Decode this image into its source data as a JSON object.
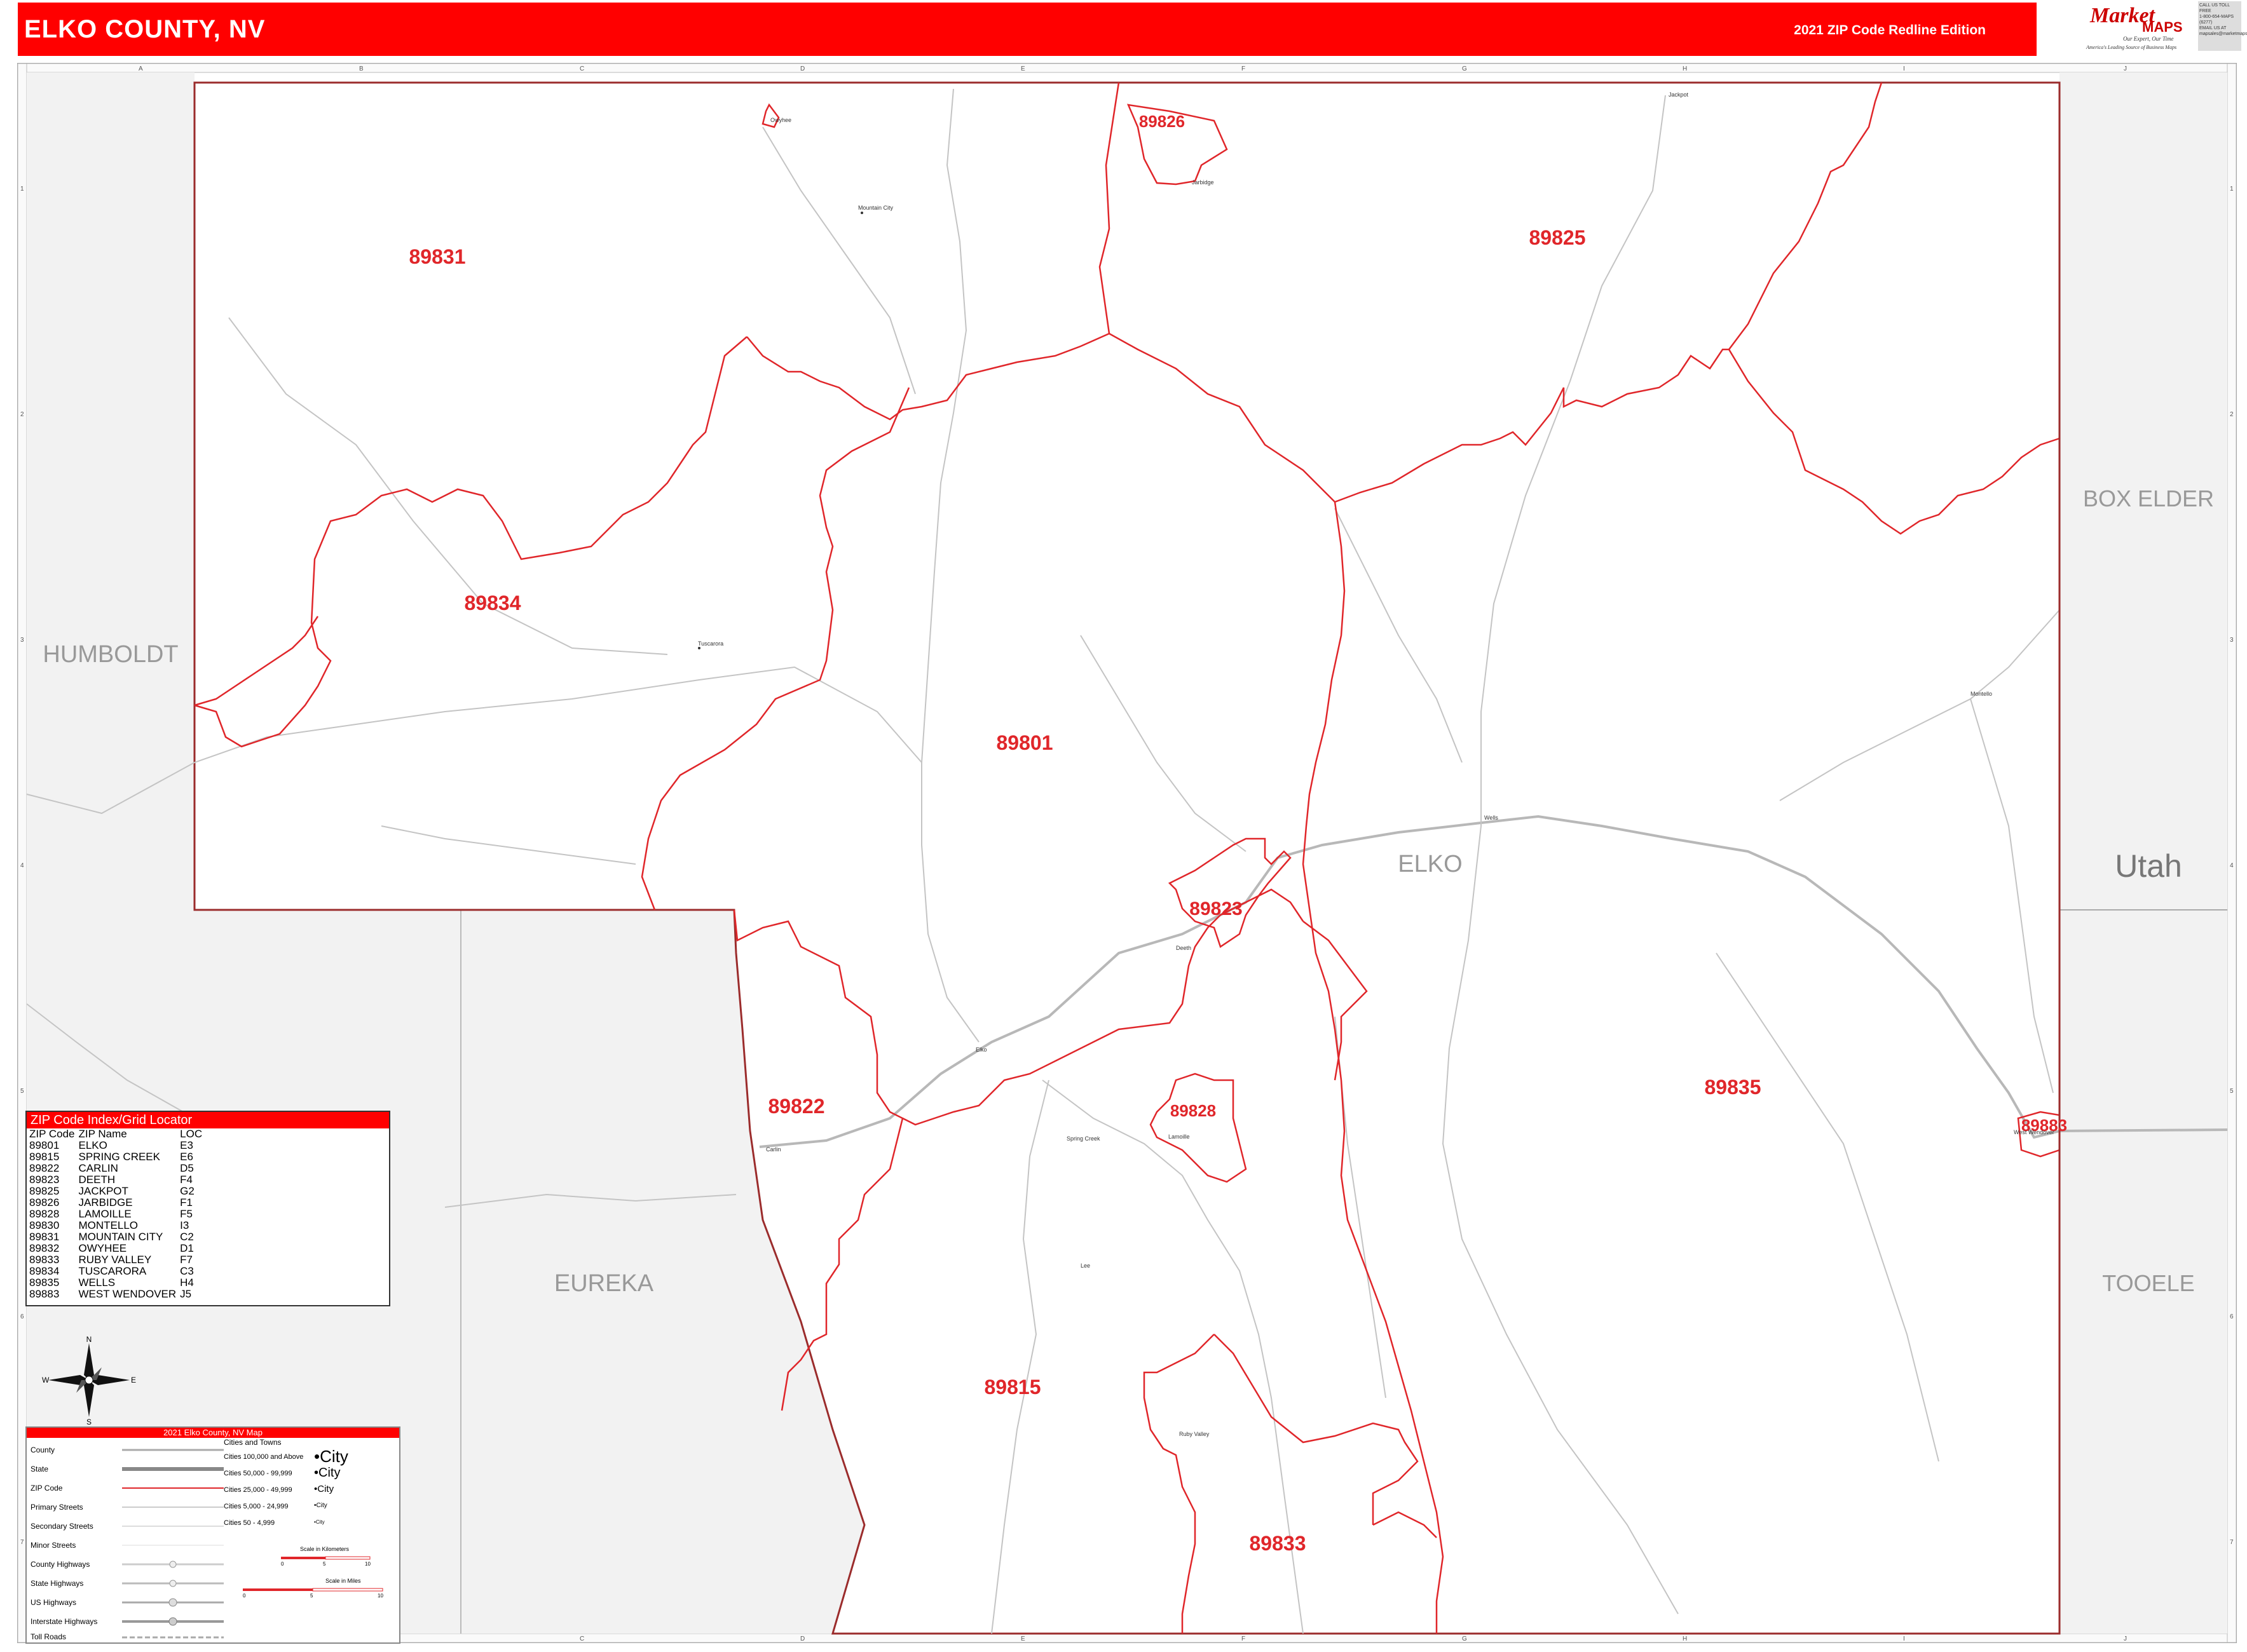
{
  "header": {
    "title": "ELKO COUNTY, NV",
    "edition": "2021 ZIP Code Redline Edition",
    "logo_brand_1": "Market",
    "logo_brand_2": "MAPS",
    "logo_tagline": "Our Expert, Our Time",
    "logo_subtagline": "America's Leading Source of Business Maps",
    "contact_lines": [
      "CALL US TOLL FREE",
      "1-800-654-MAPS (6277)",
      "EMAIL US AT",
      "mapsales@marketmaps.com"
    ]
  },
  "grid": {
    "columns": [
      "A",
      "B",
      "C",
      "D",
      "E",
      "F",
      "G",
      "H",
      "I",
      "J"
    ],
    "rows": [
      "1",
      "2",
      "3",
      "4",
      "5",
      "6",
      "7"
    ]
  },
  "neighbors": {
    "humboldt": "HUMBOLDT",
    "eureka": "EUREKA",
    "box_elder": "BOX ELDER",
    "utah": "Utah",
    "tooele": "TOOELE",
    "elko": "ELKO"
  },
  "zip_labels": {
    "z89826": "89826",
    "z89831": "89831",
    "z89825": "89825",
    "z89834": "89834",
    "z89801": "89801",
    "z89823": "89823",
    "z89822": "89822",
    "z89828": "89828",
    "z89835": "89835",
    "z89883": "89883",
    "z89815": "89815",
    "z89833": "89833"
  },
  "towns": {
    "mountain_city": "Mountain City",
    "tuscarora": "Tuscarora",
    "spring_creek": "Spring Creek",
    "lamoille": "Lamoille",
    "ruby_valley": "Ruby Valley",
    "wells": "Wells",
    "jackpot": "Jackpot",
    "montello": "Montello",
    "west_wendover": "West Wendover",
    "jarbidge": "Jarbidge",
    "carlin": "Carlin",
    "elko_city": "Elko",
    "deeth": "Deeth",
    "owyhee": "Owyhee",
    "lee": "Lee"
  },
  "zip_index": {
    "title": "ZIP Code Index/Grid Locator",
    "headers": [
      "ZIP Code",
      "ZIP Name",
      "LOC"
    ],
    "rows": [
      [
        "89801",
        "ELKO",
        "E3"
      ],
      [
        "89815",
        "SPRING CREEK",
        "E6"
      ],
      [
        "89822",
        "CARLIN",
        "D5"
      ],
      [
        "89823",
        "DEETH",
        "F4"
      ],
      [
        "89825",
        "JACKPOT",
        "G2"
      ],
      [
        "89826",
        "JARBIDGE",
        "F1"
      ],
      [
        "89828",
        "LAMOILLE",
        "F5"
      ],
      [
        "89830",
        "MONTELLO",
        "I3"
      ],
      [
        "89831",
        "MOUNTAIN CITY",
        "C2"
      ],
      [
        "89832",
        "OWYHEE",
        "D1"
      ],
      [
        "89833",
        "RUBY VALLEY",
        "F7"
      ],
      [
        "89834",
        "TUSCARORA",
        "C3"
      ],
      [
        "89835",
        "WELLS",
        "H4"
      ],
      [
        "89883",
        "WEST WENDOVER",
        "J5"
      ]
    ]
  },
  "compass": {
    "n": "N",
    "s": "S",
    "e": "E",
    "w": "W"
  },
  "legend": {
    "title": "2021 Elko County, NV Map",
    "items": [
      "County",
      "State",
      "ZIP Code",
      "Primary Streets",
      "Secondary Streets",
      "Minor Streets",
      "County Highways",
      "State Highways",
      "US Highways",
      "Interstate Highways",
      "Toll Roads"
    ],
    "cities_heading": "Cities and Towns",
    "city_classes": [
      "Cities 100,000 and Above",
      "Cities 50,000 - 99,999",
      "Cities 25,000 - 49,999",
      "Cities 5,000 - 24,999",
      "Cities 50 - 4,999"
    ],
    "city_sample": "City",
    "scale_km_label": "Scale in Kilometers",
    "scale_mi_label": "Scale in Miles",
    "scale_km_ticks": [
      "0",
      "5",
      "10"
    ],
    "scale_mi_ticks": [
      "0",
      "5",
      "10"
    ]
  },
  "colors": {
    "header_bg": "#ff0000",
    "zip_boundary": "#e0262a",
    "zip_label": "#e0262a",
    "neighbor_fill": "#f2f2f2",
    "neighbor_label": "#999999",
    "road": "#bdbdbd"
  }
}
